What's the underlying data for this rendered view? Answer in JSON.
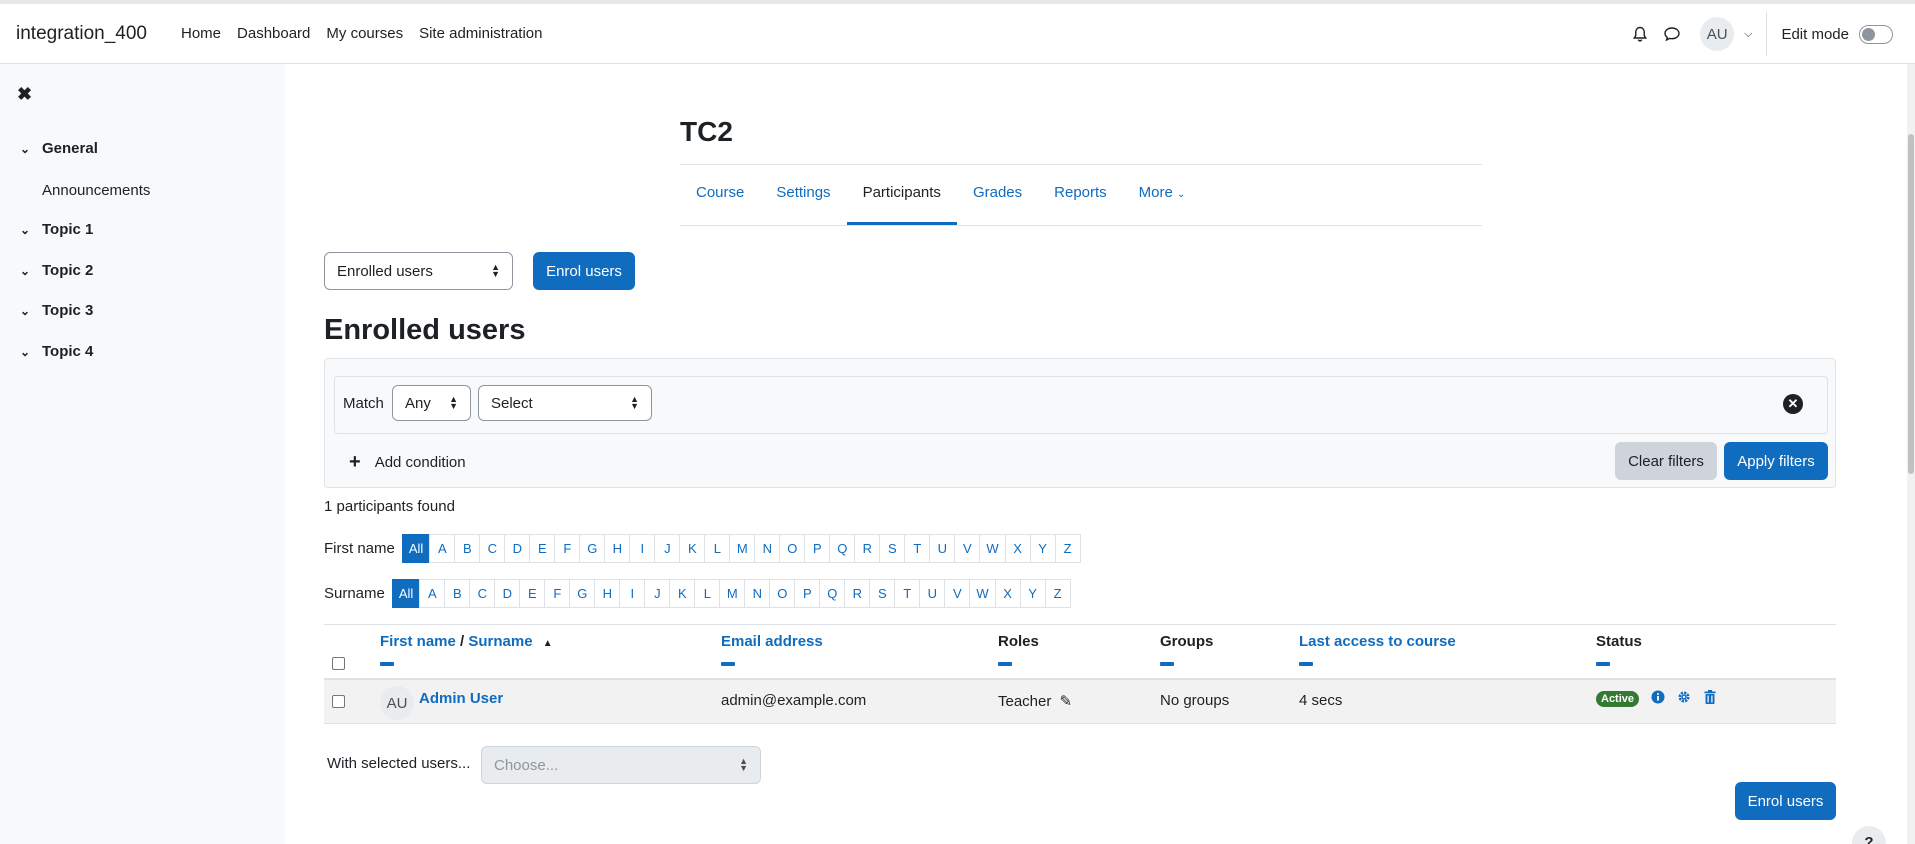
{
  "navbar": {
    "site_name": "integration_400",
    "links": [
      "Home",
      "Dashboard",
      "My courses",
      "Site administration"
    ],
    "avatar_initials": "AU",
    "edit_mode_label": "Edit mode"
  },
  "drawer": {
    "sections": [
      {
        "label": "General",
        "items": [
          "Announcements"
        ]
      },
      {
        "label": "Topic 1"
      },
      {
        "label": "Topic 2"
      },
      {
        "label": "Topic 3"
      },
      {
        "label": "Topic 4"
      }
    ]
  },
  "course": {
    "title": "TC2",
    "tabs": [
      "Course",
      "Settings",
      "Participants",
      "Grades",
      "Reports",
      "More"
    ],
    "active_tab": "Participants"
  },
  "controls": {
    "view_select": "Enrolled users",
    "enrol_button": "Enrol users"
  },
  "heading": "Enrolled users",
  "filter": {
    "match_label": "Match",
    "match_value": "Any",
    "condition_value": "Select",
    "add_condition": "Add condition",
    "clear_button": "Clear filters",
    "apply_button": "Apply filters"
  },
  "participants_found": "1 participants found",
  "initials": {
    "firstname_label": "First name",
    "surname_label": "Surname",
    "letters": [
      "All",
      "A",
      "B",
      "C",
      "D",
      "E",
      "F",
      "G",
      "H",
      "I",
      "J",
      "K",
      "L",
      "M",
      "N",
      "O",
      "P",
      "Q",
      "R",
      "S",
      "T",
      "U",
      "V",
      "W",
      "X",
      "Y",
      "Z"
    ]
  },
  "table": {
    "headers": {
      "first_name": "First name",
      "slash": " / ",
      "surname": "Surname",
      "email": "Email address",
      "roles": "Roles",
      "groups": "Groups",
      "last_access": "Last access to course",
      "status": "Status"
    },
    "rows": [
      {
        "initials": "AU",
        "name": "Admin User",
        "email": "admin@example.com",
        "role": "Teacher",
        "groups": "No groups",
        "last_access": "4 secs",
        "status": "Active"
      }
    ]
  },
  "bulk": {
    "label": "With selected users...",
    "placeholder": "Choose..."
  },
  "footer": {
    "enrol_button": "Enrol users",
    "help": "?"
  },
  "colors": {
    "primary": "#0f6cbf",
    "active_badge": "#357a32",
    "drawer_bg": "#f8f9fa"
  }
}
